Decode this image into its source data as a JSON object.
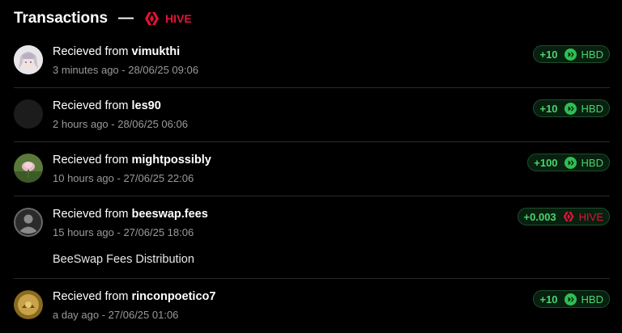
{
  "header": {
    "title": "Transactions",
    "dash": "—",
    "coin": "HIVE"
  },
  "colors": {
    "hive_red": "#e31337",
    "hbd_green": "#4ad46c",
    "muted": "#9a9a9a"
  },
  "transactions": [
    {
      "prefix": "Recieved from",
      "user": "vimukthi",
      "time": "3 minutes ago - 28/06/25 09:06",
      "amount": "+10",
      "currency": "HBD",
      "memo": "",
      "avatar": "anime-avatar"
    },
    {
      "prefix": "Recieved from",
      "user": "les90",
      "time": "2 hours ago - 28/06/25 06:06",
      "amount": "+10",
      "currency": "HBD",
      "memo": "",
      "avatar": "dark-avatar"
    },
    {
      "prefix": "Recieved from",
      "user": "mightpossibly",
      "time": "10 hours ago - 27/06/25 22:06",
      "amount": "+100",
      "currency": "HBD",
      "memo": "",
      "avatar": "flower-avatar"
    },
    {
      "prefix": "Recieved from",
      "user": "beeswap.fees",
      "time": "15 hours ago - 27/06/25 18:06",
      "amount": "+0.003",
      "currency": "HIVE",
      "memo": "BeeSwap Fees Distribution",
      "avatar": "default-user-avatar"
    },
    {
      "prefix": "Recieved from",
      "user": "rinconpoetico7",
      "time": "a day ago - 27/06/25 01:06",
      "amount": "+10",
      "currency": "HBD",
      "memo": "",
      "avatar": "golden-avatar"
    }
  ]
}
